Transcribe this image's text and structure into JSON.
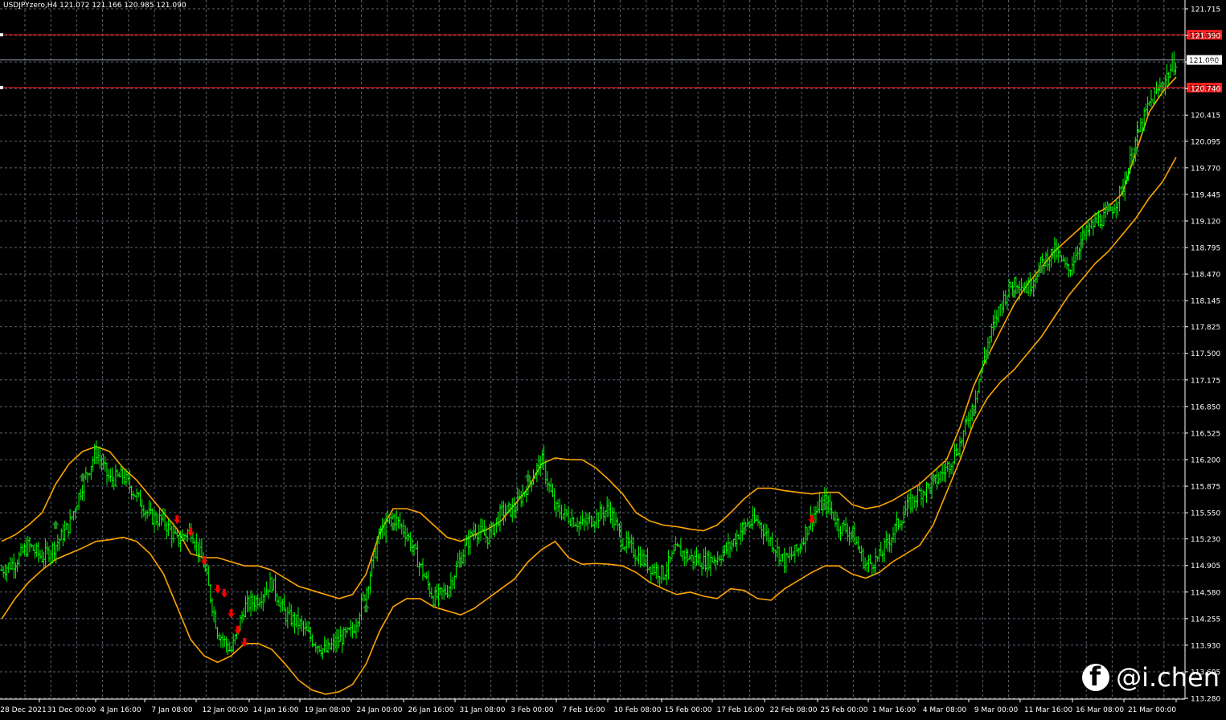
{
  "header": {
    "symbol": "USDJPYzero,H4",
    "ohlc": "121.072 121.166 120.985 121.090"
  },
  "colors": {
    "background": "#000000",
    "grid": "#5a6470",
    "candle": "#00ff00",
    "bands": "#ffa500",
    "level_line": "#ff2020",
    "price_line": "#a0a8b0",
    "buy_arrow": "#228b22",
    "sell_arrow": "#ff0000"
  },
  "watermark": {
    "text": "@i.chen",
    "icon": "facebook-icon"
  },
  "chart_data": {
    "type": "line",
    "timeframe": "H4",
    "grid": true,
    "ylim": [
      113.28,
      121.715
    ],
    "y_ticks": [
      "121.715",
      "121.390",
      "121.065",
      "120.740",
      "120.415",
      "120.095",
      "119.770",
      "119.445",
      "119.120",
      "118.795",
      "118.470",
      "118.145",
      "117.825",
      "117.500",
      "117.175",
      "116.850",
      "116.525",
      "116.200",
      "115.875",
      "115.550",
      "115.230",
      "114.905",
      "114.580",
      "114.255",
      "113.930",
      "113.605",
      "113.280"
    ],
    "x_ticks": [
      "28 Dec 2021",
      "31 Dec 00:00",
      "4 Jan 16:00",
      "7 Jan 08:00",
      "12 Jan 00:00",
      "14 Jan 16:00",
      "19 Jan 08:00",
      "24 Jan 00:00",
      "26 Jan 16:00",
      "31 Jan 08:00",
      "3 Feb 00:00",
      "7 Feb 16:00",
      "10 Feb 08:00",
      "15 Feb 00:00",
      "17 Feb 16:00",
      "22 Feb 08:00",
      "25 Feb 00:00",
      "1 Mar 16:00",
      "4 Mar 08:00",
      "9 Mar 00:00",
      "11 Mar 16:00",
      "16 Mar 08:00",
      "21 Mar 00:00"
    ],
    "levels": [
      {
        "name": "upper",
        "value": 121.398,
        "label": "121.398"
      },
      {
        "name": "lower",
        "value": 120.751,
        "label": "120.751"
      }
    ],
    "current_price": {
      "value": 121.09,
      "label": "121.090"
    },
    "price_series": [
      [
        0,
        114.85
      ],
      [
        1,
        114.95
      ],
      [
        2,
        115.15
      ],
      [
        3,
        115.0
      ],
      [
        4,
        115.15
      ],
      [
        5,
        115.4
      ],
      [
        6,
        115.9
      ],
      [
        7,
        116.3
      ],
      [
        8,
        115.95
      ],
      [
        9,
        116.0
      ],
      [
        10,
        115.75
      ],
      [
        11,
        115.5
      ],
      [
        12,
        115.45
      ],
      [
        13,
        115.2
      ],
      [
        14,
        115.35
      ],
      [
        15,
        114.9
      ],
      [
        16,
        114.1
      ],
      [
        17,
        113.85
      ],
      [
        18,
        114.4
      ],
      [
        19,
        114.5
      ],
      [
        20,
        114.7
      ],
      [
        21,
        114.3
      ],
      [
        22,
        114.2
      ],
      [
        23,
        114.0
      ],
      [
        24,
        113.85
      ],
      [
        25,
        114.0
      ],
      [
        26,
        114.1
      ],
      [
        27,
        114.6
      ],
      [
        28,
        115.3
      ],
      [
        29,
        115.5
      ],
      [
        30,
        115.3
      ],
      [
        31,
        114.9
      ],
      [
        32,
        114.5
      ],
      [
        33,
        114.6
      ],
      [
        34,
        115.0
      ],
      [
        35,
        115.35
      ],
      [
        36,
        115.25
      ],
      [
        37,
        115.55
      ],
      [
        38,
        115.6
      ],
      [
        39,
        115.9
      ],
      [
        40,
        116.2
      ],
      [
        41,
        115.6
      ],
      [
        42,
        115.5
      ],
      [
        43,
        115.4
      ],
      [
        44,
        115.5
      ],
      [
        45,
        115.6
      ],
      [
        46,
        115.2
      ],
      [
        47,
        115.05
      ],
      [
        48,
        114.9
      ],
      [
        49,
        114.8
      ],
      [
        50,
        115.1
      ],
      [
        51,
        115.0
      ],
      [
        52,
        114.95
      ],
      [
        53,
        115.0
      ],
      [
        54,
        115.15
      ],
      [
        55,
        115.4
      ],
      [
        56,
        115.45
      ],
      [
        57,
        115.2
      ],
      [
        58,
        114.95
      ],
      [
        59,
        115.1
      ],
      [
        60,
        115.5
      ],
      [
        61,
        115.7
      ],
      [
        62,
        115.4
      ],
      [
        63,
        115.3
      ],
      [
        64,
        114.9
      ],
      [
        65,
        115.0
      ],
      [
        66,
        115.3
      ],
      [
        67,
        115.6
      ],
      [
        68,
        115.8
      ],
      [
        69,
        115.9
      ],
      [
        70,
        116.1
      ],
      [
        71,
        116.4
      ],
      [
        72,
        116.9
      ],
      [
        73,
        117.6
      ],
      [
        74,
        118.1
      ],
      [
        75,
        118.4
      ],
      [
        76,
        118.3
      ],
      [
        77,
        118.6
      ],
      [
        78,
        118.75
      ],
      [
        79,
        118.5
      ],
      [
        80,
        118.9
      ],
      [
        81,
        119.1
      ],
      [
        82,
        119.2
      ],
      [
        83,
        119.5
      ],
      [
        84,
        120.1
      ],
      [
        85,
        120.55
      ],
      [
        86,
        120.8
      ],
      [
        87,
        121.09
      ]
    ],
    "upper_band": [
      [
        0,
        115.2
      ],
      [
        1,
        115.28
      ],
      [
        2,
        115.4
      ],
      [
        3,
        115.55
      ],
      [
        4,
        115.9
      ],
      [
        5,
        116.15
      ],
      [
        6,
        116.3
      ],
      [
        7,
        116.36
      ],
      [
        8,
        116.3
      ],
      [
        9,
        116.1
      ],
      [
        10,
        115.95
      ],
      [
        11,
        115.75
      ],
      [
        12,
        115.55
      ],
      [
        13,
        115.35
      ],
      [
        14,
        115.05
      ],
      [
        15,
        115.0
      ],
      [
        16,
        115.0
      ],
      [
        17,
        114.95
      ],
      [
        18,
        114.9
      ],
      [
        19,
        114.9
      ],
      [
        20,
        114.85
      ],
      [
        21,
        114.75
      ],
      [
        22,
        114.65
      ],
      [
        23,
        114.6
      ],
      [
        24,
        114.55
      ],
      [
        25,
        114.5
      ],
      [
        26,
        114.55
      ],
      [
        27,
        114.8
      ],
      [
        28,
        115.3
      ],
      [
        29,
        115.6
      ],
      [
        30,
        115.6
      ],
      [
        31,
        115.55
      ],
      [
        32,
        115.4
      ],
      [
        33,
        115.25
      ],
      [
        34,
        115.2
      ],
      [
        35,
        115.28
      ],
      [
        36,
        115.35
      ],
      [
        37,
        115.45
      ],
      [
        38,
        115.65
      ],
      [
        39,
        115.85
      ],
      [
        40,
        116.15
      ],
      [
        41,
        116.22
      ],
      [
        42,
        116.2
      ],
      [
        43,
        116.2
      ],
      [
        44,
        116.1
      ],
      [
        45,
        115.95
      ],
      [
        46,
        115.78
      ],
      [
        47,
        115.55
      ],
      [
        48,
        115.45
      ],
      [
        49,
        115.4
      ],
      [
        50,
        115.38
      ],
      [
        51,
        115.35
      ],
      [
        52,
        115.33
      ],
      [
        53,
        115.4
      ],
      [
        54,
        115.55
      ],
      [
        55,
        115.72
      ],
      [
        56,
        115.85
      ],
      [
        57,
        115.85
      ],
      [
        58,
        115.82
      ],
      [
        59,
        115.8
      ],
      [
        60,
        115.78
      ],
      [
        61,
        115.8
      ],
      [
        62,
        115.8
      ],
      [
        63,
        115.65
      ],
      [
        64,
        115.6
      ],
      [
        65,
        115.63
      ],
      [
        66,
        115.7
      ],
      [
        67,
        115.8
      ],
      [
        68,
        115.9
      ],
      [
        69,
        116.05
      ],
      [
        70,
        116.2
      ],
      [
        71,
        116.6
      ],
      [
        72,
        117.1
      ],
      [
        73,
        117.45
      ],
      [
        74,
        117.78
      ],
      [
        75,
        118.1
      ],
      [
        76,
        118.35
      ],
      [
        77,
        118.55
      ],
      [
        78,
        118.75
      ],
      [
        79,
        118.9
      ],
      [
        80,
        119.05
      ],
      [
        81,
        119.2
      ],
      [
        82,
        119.3
      ],
      [
        83,
        119.45
      ],
      [
        84,
        119.95
      ],
      [
        85,
        120.45
      ],
      [
        86,
        120.7
      ],
      [
        87,
        120.88
      ]
    ],
    "lower_band": [
      [
        0,
        114.25
      ],
      [
        1,
        114.5
      ],
      [
        2,
        114.7
      ],
      [
        3,
        114.85
      ],
      [
        4,
        114.98
      ],
      [
        5,
        115.05
      ],
      [
        6,
        115.12
      ],
      [
        7,
        115.2
      ],
      [
        8,
        115.22
      ],
      [
        9,
        115.25
      ],
      [
        10,
        115.2
      ],
      [
        11,
        115.05
      ],
      [
        12,
        114.8
      ],
      [
        13,
        114.4
      ],
      [
        14,
        114.0
      ],
      [
        15,
        113.8
      ],
      [
        16,
        113.72
      ],
      [
        17,
        113.8
      ],
      [
        18,
        113.95
      ],
      [
        19,
        113.95
      ],
      [
        20,
        113.88
      ],
      [
        21,
        113.7
      ],
      [
        22,
        113.5
      ],
      [
        23,
        113.38
      ],
      [
        24,
        113.33
      ],
      [
        25,
        113.36
      ],
      [
        26,
        113.45
      ],
      [
        27,
        113.7
      ],
      [
        28,
        114.1
      ],
      [
        29,
        114.4
      ],
      [
        30,
        114.5
      ],
      [
        31,
        114.5
      ],
      [
        32,
        114.4
      ],
      [
        33,
        114.35
      ],
      [
        34,
        114.3
      ],
      [
        35,
        114.38
      ],
      [
        36,
        114.5
      ],
      [
        37,
        114.62
      ],
      [
        38,
        114.74
      ],
      [
        39,
        114.95
      ],
      [
        40,
        115.1
      ],
      [
        41,
        115.2
      ],
      [
        42,
        115.0
      ],
      [
        43,
        114.92
      ],
      [
        44,
        114.93
      ],
      [
        45,
        114.92
      ],
      [
        46,
        114.9
      ],
      [
        47,
        114.82
      ],
      [
        48,
        114.7
      ],
      [
        49,
        114.62
      ],
      [
        50,
        114.55
      ],
      [
        51,
        114.58
      ],
      [
        52,
        114.53
      ],
      [
        53,
        114.5
      ],
      [
        54,
        114.62
      ],
      [
        55,
        114.6
      ],
      [
        56,
        114.5
      ],
      [
        57,
        114.48
      ],
      [
        58,
        114.62
      ],
      [
        59,
        114.72
      ],
      [
        60,
        114.82
      ],
      [
        61,
        114.9
      ],
      [
        62,
        114.9
      ],
      [
        63,
        114.8
      ],
      [
        64,
        114.75
      ],
      [
        65,
        114.82
      ],
      [
        66,
        114.95
      ],
      [
        67,
        115.05
      ],
      [
        68,
        115.15
      ],
      [
        69,
        115.4
      ],
      [
        70,
        115.8
      ],
      [
        71,
        116.2
      ],
      [
        72,
        116.65
      ],
      [
        73,
        116.95
      ],
      [
        74,
        117.15
      ],
      [
        75,
        117.3
      ],
      [
        76,
        117.5
      ],
      [
        77,
        117.7
      ],
      [
        78,
        117.95
      ],
      [
        79,
        118.2
      ],
      [
        80,
        118.4
      ],
      [
        81,
        118.6
      ],
      [
        82,
        118.75
      ],
      [
        83,
        118.95
      ],
      [
        84,
        119.15
      ],
      [
        85,
        119.4
      ],
      [
        86,
        119.6
      ],
      [
        87,
        119.9
      ]
    ],
    "buy_signals": [
      [
        4,
        115.42
      ],
      [
        6,
        116.0
      ],
      [
        27,
        114.4
      ],
      [
        29,
        115.4
      ],
      [
        34,
        114.95
      ],
      [
        39,
        116.0
      ],
      [
        55,
        115.35
      ],
      [
        61,
        115.65
      ],
      [
        63,
        115.3
      ],
      [
        69,
        116.0
      ],
      [
        72,
        116.8
      ],
      [
        73,
        117.5
      ],
      [
        75,
        118.25
      ],
      [
        77,
        118.55
      ],
      [
        80,
        118.85
      ],
      [
        82,
        119.3
      ],
      [
        84,
        120.0
      ],
      [
        86,
        120.8
      ]
    ],
    "sell_signals": [
      [
        13,
        115.45
      ],
      [
        14,
        115.3
      ],
      [
        15,
        114.95
      ],
      [
        16,
        114.6
      ],
      [
        16.5,
        114.55
      ],
      [
        17,
        114.3
      ],
      [
        17.5,
        114.1
      ],
      [
        18,
        113.95
      ],
      [
        60,
        115.45
      ]
    ]
  }
}
